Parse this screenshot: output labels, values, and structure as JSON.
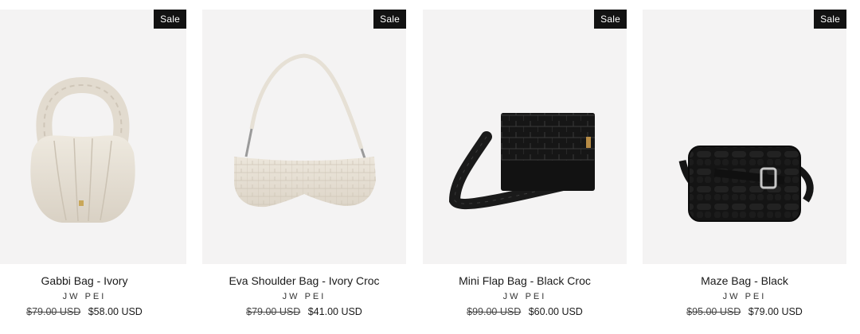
{
  "products": [
    {
      "title": "Gabbi Bag - Ivory",
      "vendor": "JW PEI",
      "compare_price": "$79.00 USD",
      "price": "$58.00 USD",
      "badge": "Sale",
      "image_icon": "ivory-ruched-hobo-bag"
    },
    {
      "title": "Eva Shoulder Bag - Ivory Croc",
      "vendor": "JW PEI",
      "compare_price": "$79.00 USD",
      "price": "$41.00 USD",
      "badge": "Sale",
      "image_icon": "ivory-croc-shoulder-bag"
    },
    {
      "title": "Mini Flap Bag - Black Croc",
      "vendor": "JW PEI",
      "compare_price": "$99.00 USD",
      "price": "$60.00 USD",
      "badge": "Sale",
      "image_icon": "black-croc-flap-bag"
    },
    {
      "title": "Maze Bag - Black",
      "vendor": "JW PEI",
      "compare_price": "$95.00 USD",
      "price": "$79.00 USD",
      "badge": "Sale",
      "image_icon": "black-woven-crossbody-bag"
    }
  ],
  "colors": {
    "image_bg": "#f4f3f3",
    "badge_bg": "#121212",
    "badge_text": "#ffffff",
    "ivory": "#e9e3d8",
    "black_bag": "#141414"
  }
}
